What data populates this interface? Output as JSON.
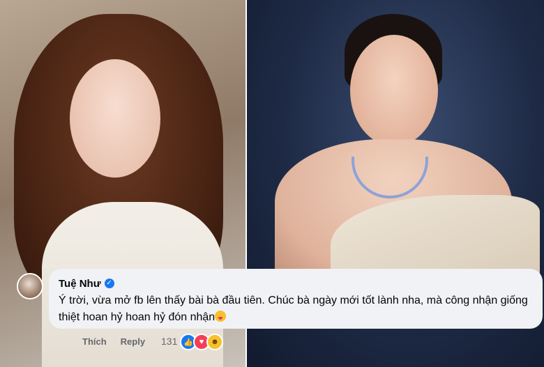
{
  "comment": {
    "author": "Tuệ Như",
    "verified": true,
    "text": "Ý trời, vừa mở fb lên thấy bài bà đầu tiên. Chúc bà ngày mới tốt lành nha, mà công nhận giống thiệt hoan hỷ hoan hỷ đón nhận",
    "emoji": "tongue-out-emoji"
  },
  "actions": {
    "like_label": "Thích",
    "reply_label": "Reply",
    "reaction_count": "131",
    "reaction_icons": [
      "like-icon",
      "love-icon",
      "haha-icon"
    ]
  },
  "colors": {
    "bubble_bg": "#f0f2f5",
    "verified_blue": "#1877f2",
    "meta_gray": "#65676b"
  }
}
